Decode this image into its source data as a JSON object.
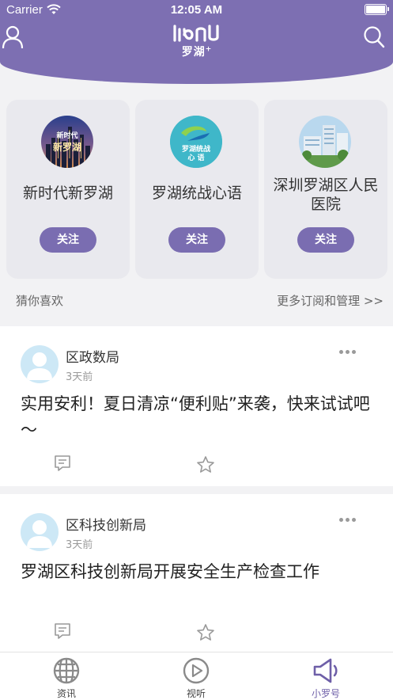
{
  "status_bar": {
    "carrier": "Carrier",
    "time": "12:05 AM"
  },
  "header": {
    "logo_text": "罗湖",
    "logo_plus": "+"
  },
  "subscriptions": [
    {
      "title": "新时代新罗湖",
      "avatar_text_line1": "新时代",
      "avatar_text_line2": "新罗湖",
      "follow_label": "关注"
    },
    {
      "title": "罗湖统战心语",
      "avatar_text_line1": "罗湖统战",
      "avatar_text_line2": "心 语",
      "follow_label": "关注"
    },
    {
      "title": "深圳罗湖区人民医院",
      "follow_label": "关注"
    }
  ],
  "guess_label": "猜你喜欢",
  "more_label": "更多订阅和管理 >>",
  "posts": [
    {
      "author": "区政数局",
      "time": "3天前",
      "text": "实用安利！夏日清凉“便利贴”来袭，快来试试吧～"
    },
    {
      "author": "区科技创新局",
      "time": "3天前",
      "text": "罗湖区科技创新局开展安全生产检查工作"
    }
  ],
  "tabs": [
    {
      "label": "资讯",
      "icon": "globe-icon"
    },
    {
      "label": "视听",
      "icon": "play-icon"
    },
    {
      "label": "小罗号",
      "icon": "speaker-icon",
      "active": true
    }
  ],
  "colors": {
    "brand": "#7d6fb2",
    "button": "#7a6db1",
    "card_bg": "#e9e9ee"
  }
}
